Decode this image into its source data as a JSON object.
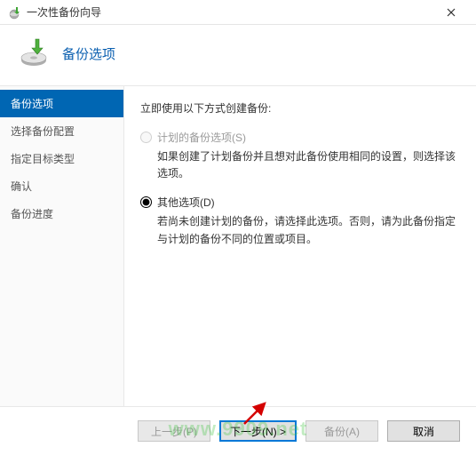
{
  "titlebar": {
    "title": "一次性备份向导"
  },
  "header": {
    "title": "备份选项"
  },
  "sidebar": {
    "items": [
      {
        "label": "备份选项",
        "active": true
      },
      {
        "label": "选择备份配置",
        "active": false
      },
      {
        "label": "指定目标类型",
        "active": false
      },
      {
        "label": "确认",
        "active": false
      },
      {
        "label": "备份进度",
        "active": false
      }
    ]
  },
  "content": {
    "intro": "立即使用以下方式创建备份:",
    "options": [
      {
        "label": "计划的备份选项(S)",
        "desc": "如果创建了计划备份并且想对此备份使用相同的设置，则选择该选项。",
        "disabled": true,
        "checked": false
      },
      {
        "label": "其他选项(D)",
        "desc": "若尚未创建计划的备份，请选择此选项。否则，请为此备份指定与计划的备份不同的位置或项目。",
        "disabled": false,
        "checked": true
      }
    ]
  },
  "footer": {
    "prev": "上一步(P)",
    "next": "下一步(N) >",
    "backup": "备份(A)",
    "cancel": "取消"
  },
  "watermark": "www.9909.net"
}
